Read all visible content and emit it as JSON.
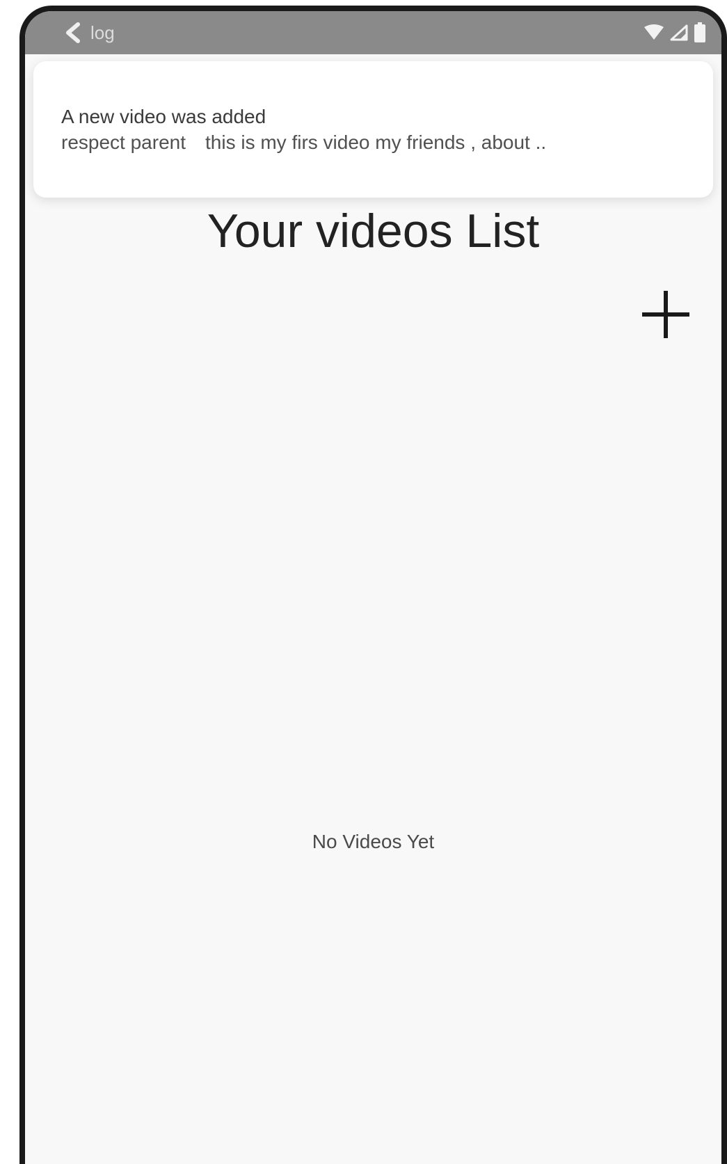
{
  "status_bar": {
    "back_label": "log"
  },
  "notification": {
    "title": "A new video was added",
    "body_video_title": "respect parent",
    "body_description": "this is my firs video my friends , about .."
  },
  "main": {
    "title": "Your videos List",
    "empty_message": "No Videos Yet"
  },
  "icons": {
    "back": "chevron-left-icon",
    "wifi": "wifi-icon",
    "signal": "signal-icon",
    "battery": "battery-icon",
    "add": "plus-icon"
  }
}
